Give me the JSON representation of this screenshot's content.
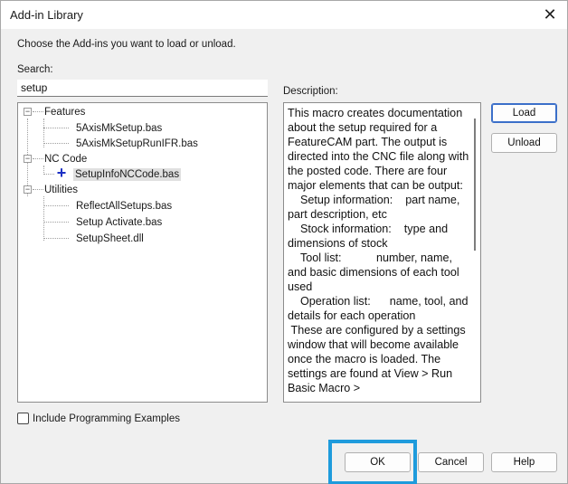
{
  "window": {
    "title": "Add-in Library"
  },
  "instruction": "Choose the Add-ins you want to load or unload.",
  "search": {
    "label": "Search:",
    "value": "setup"
  },
  "tree": {
    "groups": [
      {
        "label": "Features",
        "items": [
          "5AxisMkSetup.bas",
          "5AxisMkSetupRunIFR.bas"
        ]
      },
      {
        "label": "NC Code",
        "items": [
          "SetupInfoNCCode.bas"
        ]
      },
      {
        "label": "Utilities",
        "items": [
          "ReflectAllSetups.bas",
          "Setup Activate.bas",
          "SetupSheet.dll"
        ]
      }
    ],
    "selected_item": "SetupInfoNCCode.bas"
  },
  "description": {
    "label": "Description:",
    "text": "This macro creates documentation about the setup required for a FeatureCAM part. The output is directed into the CNC file along with the posted code. There are four major elements that can be output:\n    Setup information:    part name, part description, etc\n    Stock information:    type and dimensions of stock\n    Tool list:           number, name, and basic dimensions of each tool used\n    Operation list:      name, tool, and details for each operation\n These are configured by a settings window that will become available once the macro is loaded. The settings are found at View > Run Basic Macro >"
  },
  "buttons": {
    "load": "Load",
    "unload": "Unload",
    "ok": "OK",
    "cancel": "Cancel",
    "help": "Help"
  },
  "checkbox": {
    "label": "Include Programming Examples",
    "checked": false
  },
  "colors": {
    "highlight": "#1e9bdc",
    "default_button_border": "#3b6fc9",
    "tree_icon": "#1b2fc4"
  }
}
